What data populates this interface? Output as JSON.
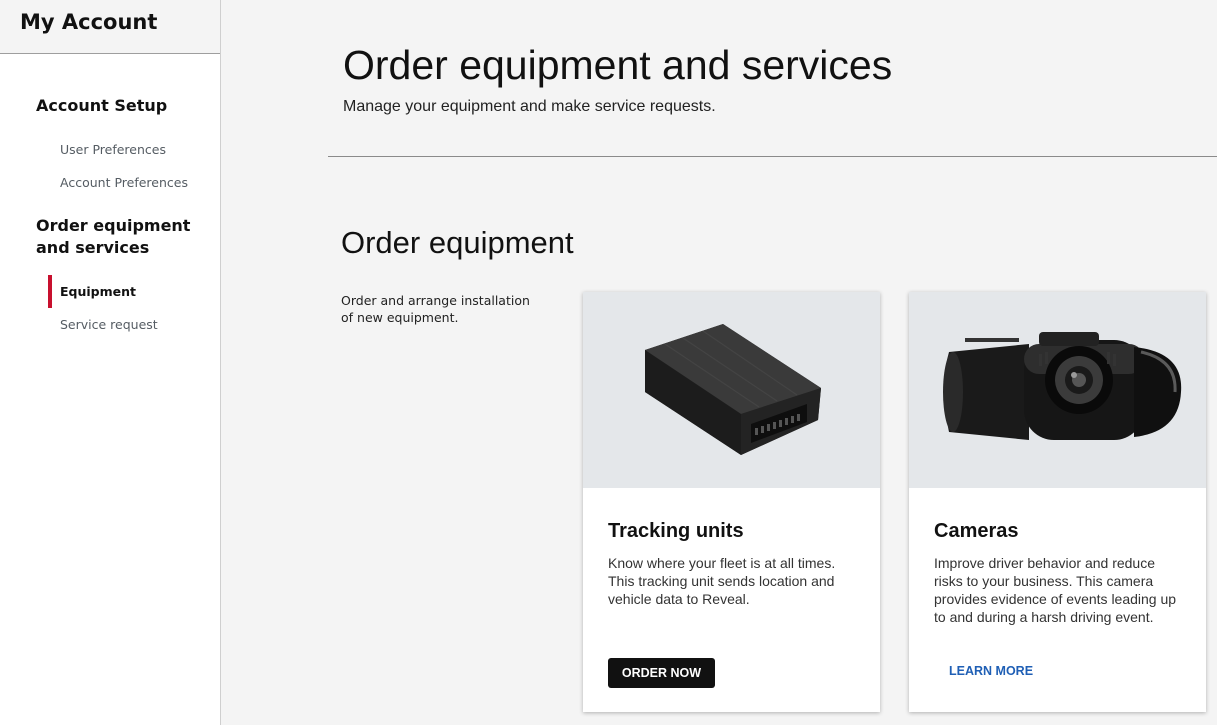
{
  "sidebar": {
    "title": "My Account",
    "sections": [
      {
        "title": "Account Setup",
        "items": [
          "User Preferences",
          "Account Preferences"
        ]
      },
      {
        "title": "Order equipment and services",
        "items": [
          "Equipment",
          "Service request"
        ],
        "active_item": "Equipment"
      }
    ],
    "accent_color": "#c8102e"
  },
  "header": {
    "title": "Order equipment and services",
    "subtitle": "Manage your equipment and make service requests."
  },
  "order_equipment": {
    "heading": "Order equipment",
    "description": "Order and arrange installation of new equipment.",
    "cards": [
      {
        "title": "Tracking units",
        "text": "Know where your fleet is at all times. This tracking unit sends location and vehicle data to Reveal.",
        "button_label": "ORDER NOW",
        "image_icon": "tracking-unit-device"
      },
      {
        "title": "Cameras",
        "text": "Improve driver behavior and reduce risks to your business. This camera provides evidence of events leading up to and during a harsh driving event.",
        "button_label": "LEARN MORE",
        "image_icon": "dash-camera"
      }
    ]
  }
}
